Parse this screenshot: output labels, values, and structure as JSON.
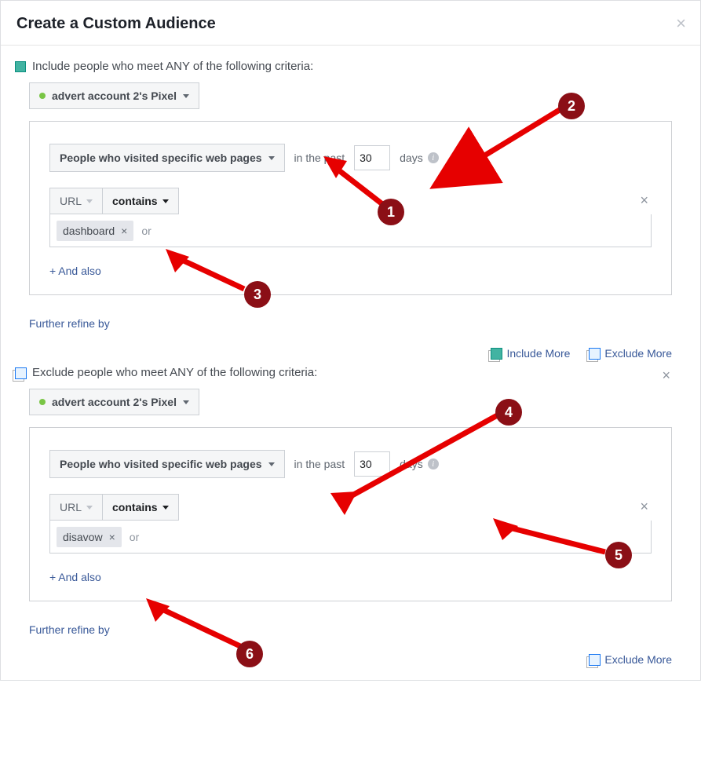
{
  "modal": {
    "title": "Create a Custom Audience"
  },
  "include_section": {
    "label": "Include people who meet ANY of the following criteria:",
    "pixel_label": "advert account 2's Pixel",
    "visitor_rule": "People who visited specific web pages",
    "in_past": "in the past",
    "days_value": "30",
    "days_label": "days",
    "url_label": "URL",
    "contains_label": "contains",
    "tag": "dashboard",
    "or_text": "or",
    "and_also": "+ And also",
    "further_refine": "Further refine by"
  },
  "actions": {
    "include_more": "Include More",
    "exclude_more": "Exclude More"
  },
  "exclude_section": {
    "label": "Exclude people who meet ANY of the following criteria:",
    "pixel_label": "advert account 2's Pixel",
    "visitor_rule": "People who visited specific web pages",
    "in_past": "in the past",
    "days_value": "30",
    "days_label": "days",
    "url_label": "URL",
    "contains_label": "contains",
    "tag": "disavow",
    "or_text": "or",
    "and_also": "+ And also",
    "further_refine": "Further refine by"
  },
  "annotations": [
    "1",
    "2",
    "3",
    "4",
    "5",
    "6"
  ]
}
